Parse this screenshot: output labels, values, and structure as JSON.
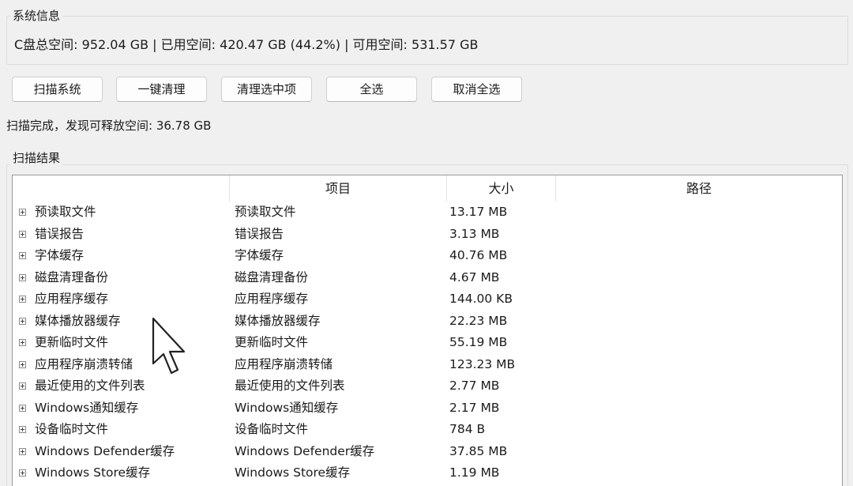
{
  "system_info": {
    "group_title": "系统信息",
    "disk_summary": "C盘总空间: 952.04 GB | 已用空间: 420.47 GB (44.2%) | 可用空间: 531.57 GB"
  },
  "toolbar": {
    "scan_label": "扫描系统",
    "one_click_clean_label": "一键清理",
    "clean_selected_label": "清理选中项",
    "select_all_label": "全选",
    "deselect_all_label": "取消全选"
  },
  "status": {
    "scan_result": "扫描完成，发现可释放空间: 36.78 GB"
  },
  "results": {
    "group_title": "扫描结果",
    "columns": [
      "",
      "项目",
      "大小",
      "路径"
    ],
    "rows": [
      {
        "name": "预读取文件",
        "item": "预读取文件",
        "size": "13.17 MB",
        "path": ""
      },
      {
        "name": "错误报告",
        "item": "错误报告",
        "size": "3.13 MB",
        "path": ""
      },
      {
        "name": "字体缓存",
        "item": "字体缓存",
        "size": "40.76 MB",
        "path": ""
      },
      {
        "name": "磁盘清理备份",
        "item": "磁盘清理备份",
        "size": "4.67 MB",
        "path": ""
      },
      {
        "name": "应用程序缓存",
        "item": "应用程序缓存",
        "size": "144.00 KB",
        "path": ""
      },
      {
        "name": "媒体播放器缓存",
        "item": "媒体播放器缓存",
        "size": "22.23 MB",
        "path": ""
      },
      {
        "name": "更新临时文件",
        "item": "更新临时文件",
        "size": "55.19 MB",
        "path": ""
      },
      {
        "name": "应用程序崩溃转储",
        "item": "应用程序崩溃转储",
        "size": "123.23 MB",
        "path": ""
      },
      {
        "name": "最近使用的文件列表",
        "item": "最近使用的文件列表",
        "size": "2.77 MB",
        "path": ""
      },
      {
        "name": "Windows通知缓存",
        "item": "Windows通知缓存",
        "size": "2.17 MB",
        "path": ""
      },
      {
        "name": "设备临时文件",
        "item": "设备临时文件",
        "size": "784 B",
        "path": ""
      },
      {
        "name": "Windows Defender缓存",
        "item": "Windows Defender缓存",
        "size": "37.85 MB",
        "path": ""
      },
      {
        "name": "Windows Store缓存",
        "item": "Windows Store缓存",
        "size": "1.19 MB",
        "path": ""
      }
    ]
  },
  "icons": {
    "expand": "plus-box-icon",
    "cursor": "mouse-pointer-icon"
  },
  "colors": {
    "window_bg": "#f0f0f0",
    "list_bg": "#ffffff",
    "border": "#9a9a9a"
  }
}
